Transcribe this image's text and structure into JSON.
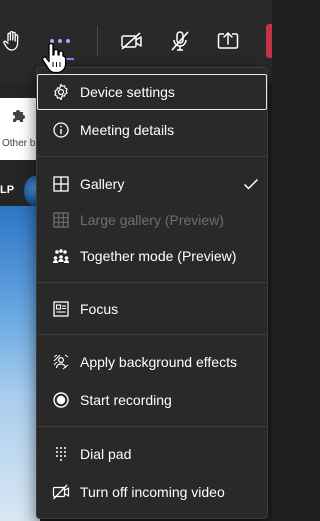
{
  "toolbar": {
    "items": [
      {
        "name": "raise-hand",
        "icon": "hand-icon"
      },
      {
        "name": "more-actions",
        "icon": "more-dots-icon"
      },
      {
        "name": "camera-off",
        "icon": "video-off-icon"
      },
      {
        "name": "mic-off",
        "icon": "mic-off-icon"
      },
      {
        "name": "share",
        "icon": "share-screen-icon"
      }
    ],
    "accent": "#7f85f5",
    "leave_color": "#c4314b"
  },
  "background": {
    "card_text": "Other b",
    "initials": "LP"
  },
  "menu": {
    "items": [
      {
        "label": "Device settings",
        "icon": "gear-icon",
        "focused": true
      },
      {
        "label": "Meeting details",
        "icon": "info-icon"
      },
      {
        "label": "Gallery",
        "icon": "grid-icon",
        "checked": true
      },
      {
        "label": "Large gallery (Preview)",
        "icon": "grid-icon",
        "disabled": true
      },
      {
        "label": "Together mode (Preview)",
        "icon": "people-group-icon"
      },
      {
        "label": "Focus",
        "icon": "focus-icon"
      },
      {
        "label": "Apply background effects",
        "icon": "background-effects-icon"
      },
      {
        "label": "Start recording",
        "icon": "record-icon"
      },
      {
        "label": "Dial pad",
        "icon": "dial-pad-icon"
      },
      {
        "label": "Turn off incoming video",
        "icon": "video-off-icon"
      }
    ]
  }
}
